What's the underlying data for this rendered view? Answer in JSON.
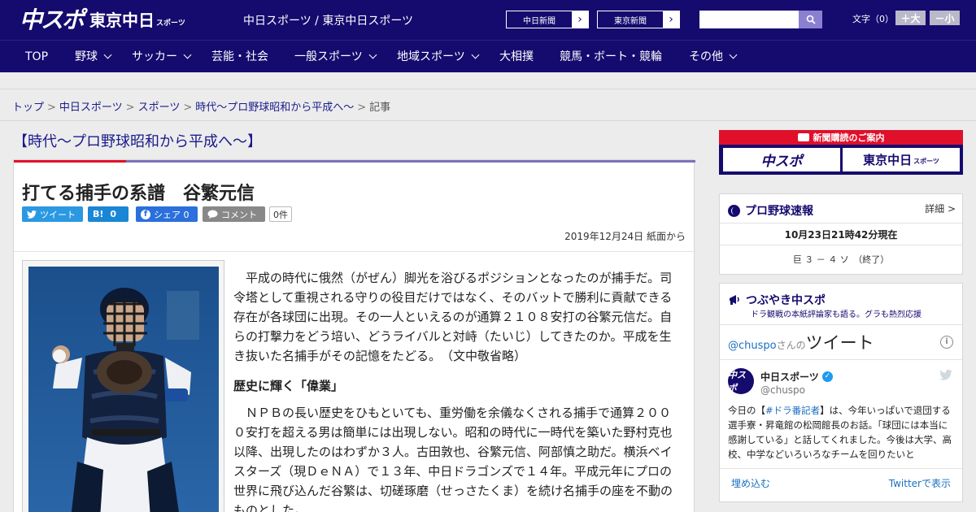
{
  "header": {
    "logo_chuspo": "中スポ",
    "logo_tokyo": "東京中日",
    "logo_tokyo_suffix": "スポーツ",
    "site_title": "中日スポーツ / 東京中日スポーツ",
    "paper_links": [
      "中日新聞",
      "東京新聞"
    ],
    "search_placeholder": "",
    "font_size_label": "文字（0）",
    "font_bigger": "＋大",
    "font_smaller": "－小"
  },
  "nav": {
    "items": [
      {
        "label": "TOP"
      },
      {
        "label": "野球"
      },
      {
        "label": "サッカー"
      },
      {
        "label": "芸能・社会"
      },
      {
        "label": "一般スポーツ"
      },
      {
        "label": "地域スポーツ"
      },
      {
        "label": "大相撲"
      },
      {
        "label": "競馬・ボート・競輪"
      },
      {
        "label": "その他"
      }
    ]
  },
  "breadcrumb": {
    "items": [
      "トップ",
      "中日スポーツ",
      "スポーツ",
      "時代～プロ野球昭和から平成へ～"
    ],
    "current": "記事",
    "separator": ">"
  },
  "article": {
    "section": "【時代～プロ野球昭和から平成へ～】",
    "title": "打てる捕手の系譜　谷繁元信",
    "share": {
      "tweet": "ツイート",
      "hatena": "0",
      "facebook": "シェア 0",
      "comment": "コメント",
      "count": "0件"
    },
    "date": "2019年12月24日 紙面から",
    "paragraph1": "平成の時代に俄然（がぜん）脚光を浴びるポジションとなったのが捕手だ。司令塔として重視される守りの役目だけではなく、そのバットで勝利に貢献できる存在が各球団に出現。その一人といえるのが通算２１０８安打の谷繁元信だ。自らの打撃力をどう培い、どうライバルと対峙（たいじ）してきたのか。平成を生き抜いた名捕手がその記憶をたどる。　（文中敬省略）",
    "subheading": "歴史に輝く「偉業」",
    "paragraph2": "ＮＰＢの長い歴史をひもといても、重労働を余儀なくされる捕手で通算２０００安打を超える男は簡単には出現しない。昭和の時代に一時代を築いた野村克也以降、出現したのはわずか３人。古田敦也、谷繁元信、阿部慎之助だ。横浜ベイスターズ（現ＤｅＮＡ）で１３年、中日ドラゴンズで１４年。平成元年にプロの世界に飛び込んだ谷繁は、切磋琢磨（せっさたくま）を続け名捕手の座を不動のものとした。"
  },
  "sidebar": {
    "subscription": {
      "header": "新聞購読のご案内",
      "box1": "中スポ",
      "box2": "東京中日",
      "box2_suffix": "スポーツ"
    },
    "baseball": {
      "title": "プロ野球速報",
      "detail": "詳細 >",
      "time": "10月23日21時42分現在",
      "score": "巨 ３ － ４ ソ　（終了）"
    },
    "twitter": {
      "title": "つぶやき中スポ",
      "subtitle": "ドラ観戦の本紙評論家も語る。グラも熱烈応援",
      "head_handle": "@chuspo",
      "head_mid": "さんの",
      "head_big": "ツイート",
      "info": "i",
      "avatar_text": "中スポ",
      "name": "中日スポーツ",
      "handle": "@chuspo",
      "text_prefix": "今日の【",
      "text_hashtag": "#ドラ番記者",
      "text_body": "】は、今年いっぱいで退団する選手寮・昇竜館の松岡館長のお話。「球団には本当に感謝している」と話してくれました。今後は大学、高校、中学などいろいろなチームを回りたいと",
      "embed": "埋め込む",
      "view": "Twitterで表示"
    }
  },
  "colors": {
    "brand_navy": "#150a6e",
    "accent_red": "#e0102a",
    "link_blue": "#1a1a8c"
  }
}
